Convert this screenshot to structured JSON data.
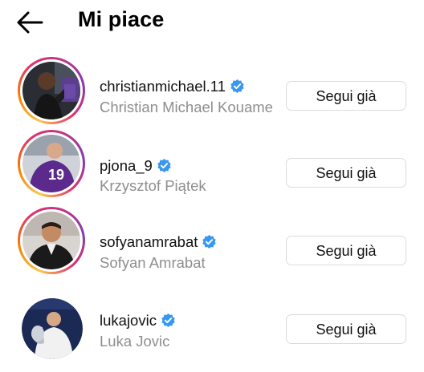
{
  "header": {
    "title": "Mi piace",
    "back_icon": "arrow-left-icon"
  },
  "likes": [
    {
      "username": "christianmichael.11",
      "full_name": "Christian Michael Kouame",
      "verified": true,
      "has_story_ring": true,
      "button_label": "Segui già"
    },
    {
      "username": "pjona_9",
      "full_name": "Krzysztof Piątek",
      "verified": true,
      "has_story_ring": true,
      "jersey_number": "19",
      "button_label": "Segui già"
    },
    {
      "username": "sofyanamrabat",
      "full_name": "Sofyan Amrabat",
      "verified": true,
      "has_story_ring": true,
      "button_label": "Segui già"
    },
    {
      "username": "lukajovic",
      "full_name": "Luka Jovic",
      "verified": true,
      "has_story_ring": false,
      "button_label": "Segui già"
    }
  ],
  "colors": {
    "verified_blue": "#3897f0",
    "secondary_text": "#8e8e8e",
    "button_border": "#dbdbdb"
  }
}
